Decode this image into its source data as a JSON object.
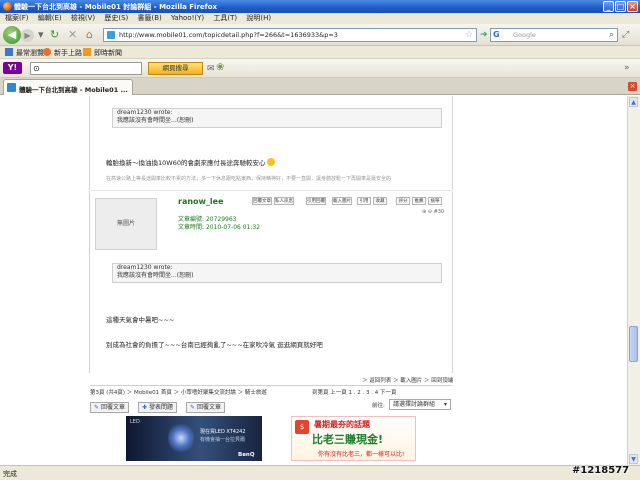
{
  "window": {
    "title": "體驗一下台北到高雄 - Mobile01 討論群組 - Mozilla Firefox",
    "controls": [
      "_",
      "□",
      "×"
    ]
  },
  "menu": [
    "檔案(F)",
    "編輯(E)",
    "檢視(V)",
    "歷史(S)",
    "書籤(B)",
    "Yahoo!(Y)",
    "工具(T)",
    "說明(H)"
  ],
  "nav": {
    "url": "http://www.mobile01.com/topicdetail.php?f=266&t=1636933&p=3",
    "search_placeholder": "Google"
  },
  "bookmarks": [
    "最常瀏覽",
    "新手上路",
    "即時新聞"
  ],
  "yahoo": {
    "logo": "Y!",
    "search_button": "網頁搜尋"
  },
  "tab": {
    "label": "體驗一下台北到高雄 - Mobile01 ..."
  },
  "post1": {
    "quote_author": "dream1230 wrote:",
    "quote_text": "我應該沒有會時間坐...(恕刪)",
    "body": "輪胎換新～換油換10W60的會劇來應付長途奔馳較安心",
    "signature": "在高速公路上等長途開車比較不累的方法，多一下休息跟吃點東西，保持精神好，不要一直開，讓身體放鬆一下再開車是最安全的"
  },
  "post2": {
    "avatar_text": "無圖片",
    "username": "ranow_lee",
    "buttons": [
      "回覆文章",
      "私人訊息",
      "引用回覆",
      "載入圖片",
      "引用",
      "收藏",
      "評分",
      "推薦",
      "檢舉"
    ],
    "page_counter": "#30",
    "meta_posts_label": "文章編號:",
    "meta_posts": "20729963",
    "meta_date_label": "文章時間:",
    "meta_date": "2010-07-06 01:32",
    "quote_author": "dream1230 wrote:",
    "quote_text": "我應該沒有會時間坐...(恕刪)",
    "body_line1": "這種天氣會中暑吧~~~",
    "body_line2": "別成為社會的負擔了~~~台南已經夠亂了~~~在家吹冷氣 逛逛網頁就好吧"
  },
  "post_footer": "＞ 返回列表 ＞ 載入圖片 ＞ 回到頂端",
  "pager": {
    "left": "第3頁 (共4頁) ＞ Mobile01 首頁 ＞ 小眾嗜好聚集交流討論 ＞ 騎士旅遊",
    "right": "到第頁 上一頁 1 . 2 . 3 . 4 下一頁",
    "jump_label": "前往:",
    "jump_value": "請選擇討論群組"
  },
  "actions": [
    "回覆文章",
    "發表問題",
    "回覆文章"
  ],
  "ads": {
    "ad1_led": "LED",
    "ad1_line1": "現在買LED XT4242",
    "ad1_line2": "有機會抽一台拉貝爾",
    "ad1_brand": "BenQ",
    "ad2_top": "暑期最夯的話題",
    "ad2_main": "比老三賺現金!",
    "ad2_sub": "你有沒有比老三，都一樣可以比!"
  },
  "status": "完成",
  "watermark": "#1218577"
}
